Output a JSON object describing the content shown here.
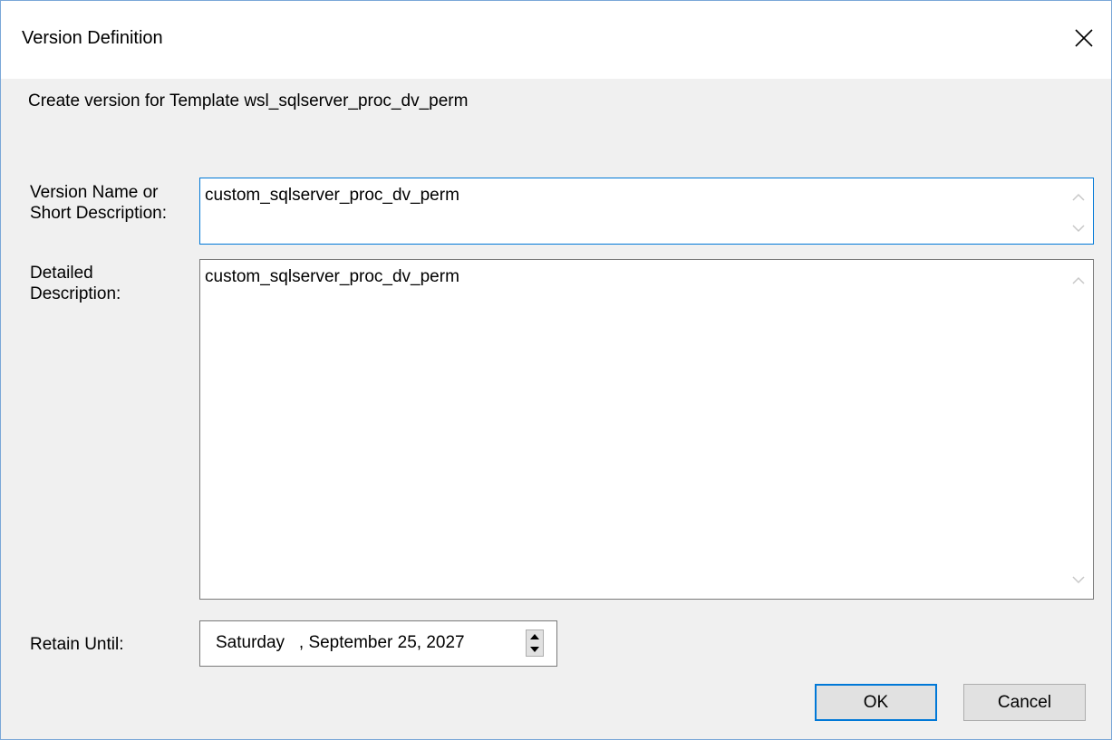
{
  "window": {
    "title": "Version Definition",
    "close_icon": "close-icon"
  },
  "dialog": {
    "subtitle": "Create version for Template wsl_sqlserver_proc_dv_perm",
    "version_name_label_line1": "Version Name or",
    "version_name_label_line2": "Short Description:",
    "version_name_value": "custom_sqlserver_proc_dv_perm",
    "detailed_label_line1": "Detailed",
    "detailed_label_line2": "Description:",
    "detailed_value": "custom_sqlserver_proc_dv_perm",
    "retain_label": "Retain Until:",
    "retain_value": "Saturday   , September 25, 2027",
    "ok_label": "OK",
    "cancel_label": "Cancel"
  },
  "colors": {
    "focus_border": "#0078d7",
    "window_border": "#7aa7d8",
    "background": "#f0f0f0"
  }
}
